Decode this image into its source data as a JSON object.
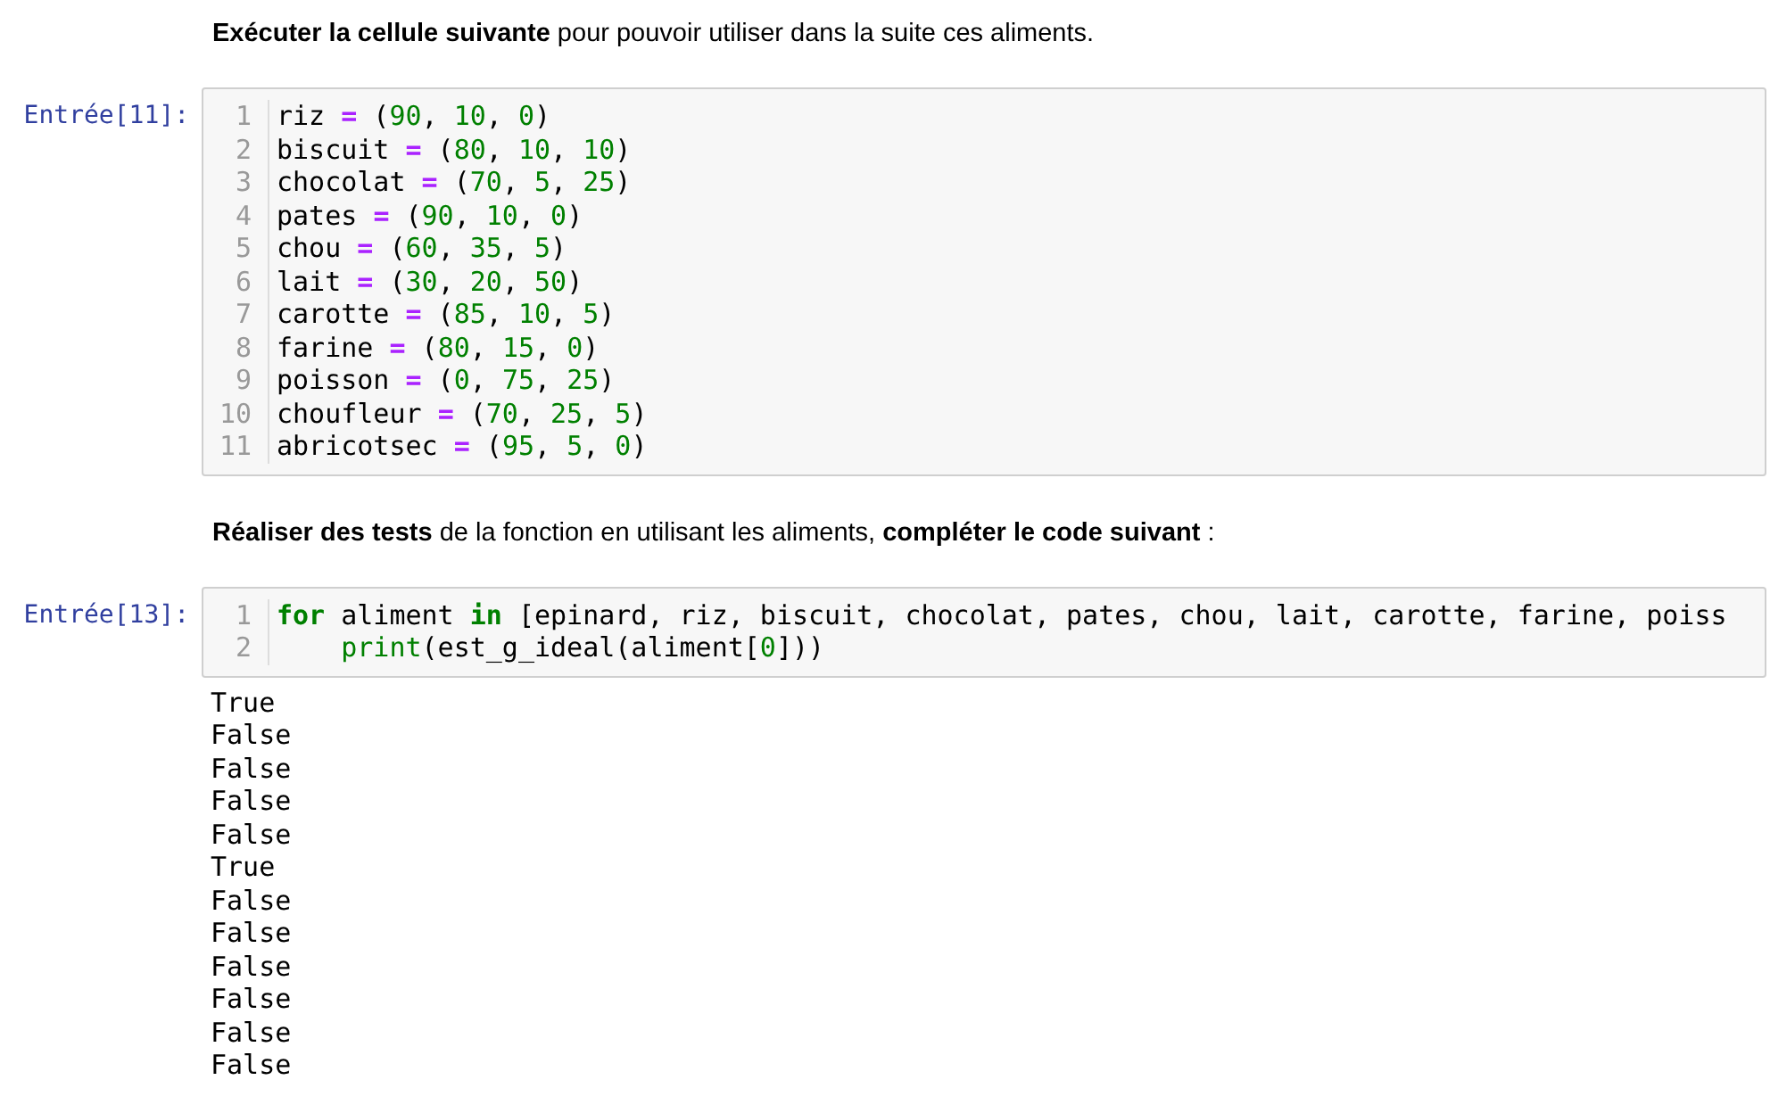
{
  "cells": [
    {
      "kind": "markdown",
      "text": "**Exécuter la cellule suivante** pour pouvoir utiliser dans la suite ces aliments."
    },
    {
      "kind": "code",
      "prompt": "Entrée[11]:",
      "lines": [
        {
          "number": "1",
          "tokens": [
            {
              "kind": "plain",
              "text": "riz "
            },
            {
              "kind": "op",
              "text": "="
            },
            {
              "kind": "plain",
              "text": " ("
            },
            {
              "kind": "num",
              "text": "90"
            },
            {
              "kind": "plain",
              "text": ", "
            },
            {
              "kind": "num",
              "text": "10"
            },
            {
              "kind": "plain",
              "text": ", "
            },
            {
              "kind": "num",
              "text": "0"
            },
            {
              "kind": "plain",
              "text": ")"
            }
          ]
        },
        {
          "number": "2",
          "tokens": [
            {
              "kind": "plain",
              "text": "biscuit "
            },
            {
              "kind": "op",
              "text": "="
            },
            {
              "kind": "plain",
              "text": " ("
            },
            {
              "kind": "num",
              "text": "80"
            },
            {
              "kind": "plain",
              "text": ", "
            },
            {
              "kind": "num",
              "text": "10"
            },
            {
              "kind": "plain",
              "text": ", "
            },
            {
              "kind": "num",
              "text": "10"
            },
            {
              "kind": "plain",
              "text": ")"
            }
          ]
        },
        {
          "number": "3",
          "tokens": [
            {
              "kind": "plain",
              "text": "chocolat "
            },
            {
              "kind": "op",
              "text": "="
            },
            {
              "kind": "plain",
              "text": " ("
            },
            {
              "kind": "num",
              "text": "70"
            },
            {
              "kind": "plain",
              "text": ", "
            },
            {
              "kind": "num",
              "text": "5"
            },
            {
              "kind": "plain",
              "text": ", "
            },
            {
              "kind": "num",
              "text": "25"
            },
            {
              "kind": "plain",
              "text": ")"
            }
          ]
        },
        {
          "number": "4",
          "tokens": [
            {
              "kind": "plain",
              "text": "pates "
            },
            {
              "kind": "op",
              "text": "="
            },
            {
              "kind": "plain",
              "text": " ("
            },
            {
              "kind": "num",
              "text": "90"
            },
            {
              "kind": "plain",
              "text": ", "
            },
            {
              "kind": "num",
              "text": "10"
            },
            {
              "kind": "plain",
              "text": ", "
            },
            {
              "kind": "num",
              "text": "0"
            },
            {
              "kind": "plain",
              "text": ")"
            }
          ]
        },
        {
          "number": "5",
          "tokens": [
            {
              "kind": "plain",
              "text": "chou "
            },
            {
              "kind": "op",
              "text": "="
            },
            {
              "kind": "plain",
              "text": " ("
            },
            {
              "kind": "num",
              "text": "60"
            },
            {
              "kind": "plain",
              "text": ", "
            },
            {
              "kind": "num",
              "text": "35"
            },
            {
              "kind": "plain",
              "text": ", "
            },
            {
              "kind": "num",
              "text": "5"
            },
            {
              "kind": "plain",
              "text": ")"
            }
          ]
        },
        {
          "number": "6",
          "tokens": [
            {
              "kind": "plain",
              "text": "lait "
            },
            {
              "kind": "op",
              "text": "="
            },
            {
              "kind": "plain",
              "text": " ("
            },
            {
              "kind": "num",
              "text": "30"
            },
            {
              "kind": "plain",
              "text": ", "
            },
            {
              "kind": "num",
              "text": "20"
            },
            {
              "kind": "plain",
              "text": ", "
            },
            {
              "kind": "num",
              "text": "50"
            },
            {
              "kind": "plain",
              "text": ")"
            }
          ]
        },
        {
          "number": "7",
          "tokens": [
            {
              "kind": "plain",
              "text": "carotte "
            },
            {
              "kind": "op",
              "text": "="
            },
            {
              "kind": "plain",
              "text": " ("
            },
            {
              "kind": "num",
              "text": "85"
            },
            {
              "kind": "plain",
              "text": ", "
            },
            {
              "kind": "num",
              "text": "10"
            },
            {
              "kind": "plain",
              "text": ", "
            },
            {
              "kind": "num",
              "text": "5"
            },
            {
              "kind": "plain",
              "text": ")"
            }
          ]
        },
        {
          "number": "8",
          "tokens": [
            {
              "kind": "plain",
              "text": "farine "
            },
            {
              "kind": "op",
              "text": "="
            },
            {
              "kind": "plain",
              "text": " ("
            },
            {
              "kind": "num",
              "text": "80"
            },
            {
              "kind": "plain",
              "text": ", "
            },
            {
              "kind": "num",
              "text": "15"
            },
            {
              "kind": "plain",
              "text": ", "
            },
            {
              "kind": "num",
              "text": "0"
            },
            {
              "kind": "plain",
              "text": ")"
            }
          ]
        },
        {
          "number": "9",
          "tokens": [
            {
              "kind": "plain",
              "text": "poisson "
            },
            {
              "kind": "op",
              "text": "="
            },
            {
              "kind": "plain",
              "text": " ("
            },
            {
              "kind": "num",
              "text": "0"
            },
            {
              "kind": "plain",
              "text": ", "
            },
            {
              "kind": "num",
              "text": "75"
            },
            {
              "kind": "plain",
              "text": ", "
            },
            {
              "kind": "num",
              "text": "25"
            },
            {
              "kind": "plain",
              "text": ")"
            }
          ]
        },
        {
          "number": "10",
          "tokens": [
            {
              "kind": "plain",
              "text": "choufleur "
            },
            {
              "kind": "op",
              "text": "="
            },
            {
              "kind": "plain",
              "text": " ("
            },
            {
              "kind": "num",
              "text": "70"
            },
            {
              "kind": "plain",
              "text": ", "
            },
            {
              "kind": "num",
              "text": "25"
            },
            {
              "kind": "plain",
              "text": ", "
            },
            {
              "kind": "num",
              "text": "5"
            },
            {
              "kind": "plain",
              "text": ")"
            }
          ]
        },
        {
          "number": "11",
          "tokens": [
            {
              "kind": "plain",
              "text": "abricotsec "
            },
            {
              "kind": "op",
              "text": "="
            },
            {
              "kind": "plain",
              "text": " ("
            },
            {
              "kind": "num",
              "text": "95"
            },
            {
              "kind": "plain",
              "text": ", "
            },
            {
              "kind": "num",
              "text": "5"
            },
            {
              "kind": "plain",
              "text": ", "
            },
            {
              "kind": "num",
              "text": "0"
            },
            {
              "kind": "plain",
              "text": ")"
            }
          ]
        }
      ]
    },
    {
      "kind": "markdown",
      "text": "**Réaliser des tests** de la fonction en utilisant les aliments, **compléter le code suivant** :"
    },
    {
      "kind": "code",
      "prompt": "Entrée[13]:",
      "lines": [
        {
          "number": "1",
          "tokens": [
            {
              "kind": "keyword",
              "text": "for"
            },
            {
              "kind": "plain",
              "text": " aliment "
            },
            {
              "kind": "keyword",
              "text": "in"
            },
            {
              "kind": "plain",
              "text": " [epinard, riz, biscuit, chocolat, pates, chou, lait, carotte, farine, poiss"
            }
          ]
        },
        {
          "number": "2",
          "indented": true,
          "tokens": [
            {
              "kind": "builtin",
              "text": "print"
            },
            {
              "kind": "plain",
              "text": "(est_g_ideal(aliment["
            },
            {
              "kind": "num",
              "text": "0"
            },
            {
              "kind": "plain",
              "text": "]))"
            }
          ]
        }
      ],
      "outputs": [
        "True",
        "False",
        "False",
        "False",
        "False",
        "True",
        "False",
        "False",
        "False",
        "False",
        "False",
        "False"
      ]
    }
  ]
}
